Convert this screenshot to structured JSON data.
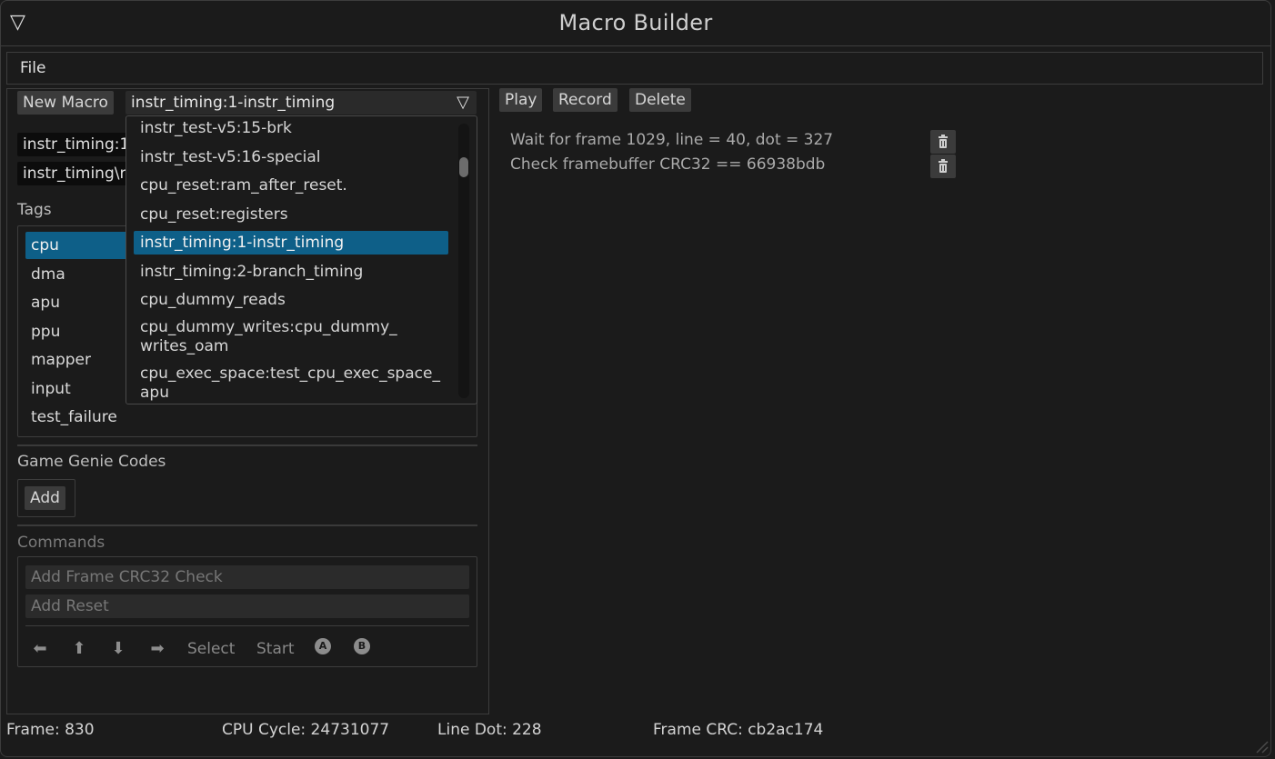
{
  "window": {
    "title": "Macro Builder",
    "collapse_icon": "triangle-down-icon"
  },
  "menubar": {
    "file": "File"
  },
  "toolbar": {
    "new_macro": "New Macro",
    "selected_macro": "instr_timing:1-instr_timing",
    "play": "Play",
    "record": "Record",
    "delete": "Delete"
  },
  "macro_fields": {
    "name_value": "instr_timing:1",
    "path_value": "instr_timing\\r"
  },
  "tags": {
    "label": "Tags",
    "items": [
      "cpu",
      "dma",
      "apu",
      "ppu",
      "mapper",
      "input",
      "test_failure"
    ],
    "selected": "cpu"
  },
  "game_genie": {
    "label": "Game Genie Codes",
    "add": "Add"
  },
  "commands": {
    "label": "Commands",
    "add_crc_check": "Add Frame CRC32 Check",
    "add_reset": "Add Reset",
    "pad": {
      "left": "⬅",
      "up": "⬆",
      "down": "⬇",
      "right": "➡",
      "select": "Select",
      "start": "Start",
      "a": "A",
      "b": "B"
    }
  },
  "dropdown": {
    "items": [
      "instr_test-v5:15-brk",
      "instr_test-v5:16-special",
      "cpu_reset:ram_after_reset.",
      "cpu_reset:registers",
      "instr_timing:1-instr_timing",
      "instr_timing:2-branch_timing",
      "cpu_dummy_reads",
      "cpu_dummy_writes:cpu_dummy_\nwrites_oam",
      "cpu_exec_space:test_cpu_exec_space_\napu"
    ],
    "selected_index": 4
  },
  "steps": [
    "Wait for frame 1029, line = 40, dot = 327",
    "Check framebuffer CRC32 == 66938bdb"
  ],
  "status_bar": {
    "frame": "Frame: 830",
    "cpu_cycle": "CPU Cycle: 24731077",
    "line_dot": "Line Dot: 228",
    "frame_crc": "Frame CRC: cb2ac174"
  },
  "colors": {
    "background": "#1b1b1b",
    "selection": "#0e5f88",
    "button": "#3b3b3b",
    "border": "#3d3d3d"
  }
}
